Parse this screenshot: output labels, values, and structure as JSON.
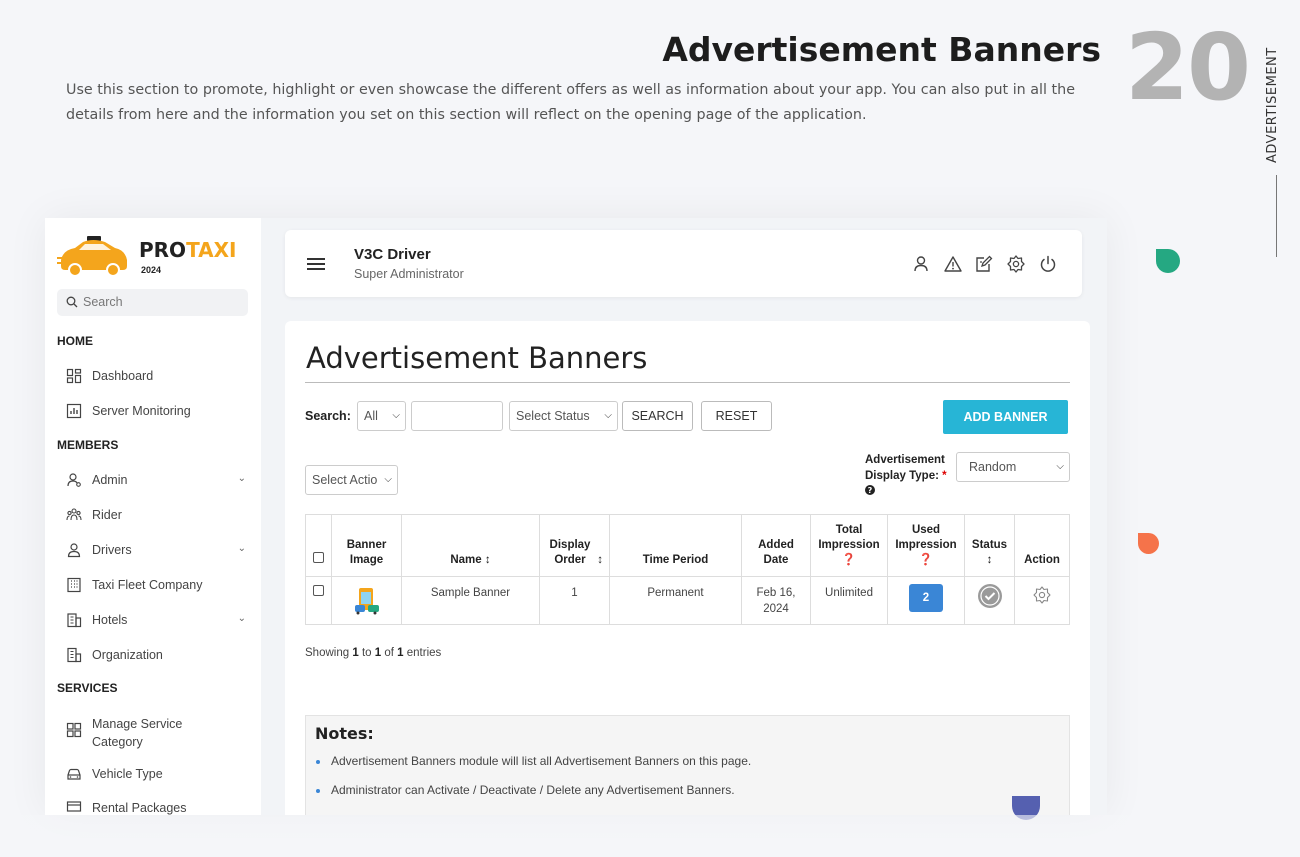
{
  "doc": {
    "title": "Advertisement Banners",
    "description": "Use this section to promote, highlight or even showcase the different offers as well as information about your app. You can also put in all the details from here and the information you set on this section will reflect on the opening page of the application.",
    "number": "20",
    "side_label": "ADVERTISEMENT"
  },
  "brand": {
    "name_a": "PRO",
    "name_b": "TAXI",
    "year": "2024",
    "accent": "#f4a51c"
  },
  "sidebar": {
    "search_placeholder": "Search",
    "sections": {
      "home": "HOME",
      "members": "MEMBERS",
      "services": "SERVICES"
    },
    "items": [
      {
        "label": "Dashboard",
        "icon": "dashboard-icon"
      },
      {
        "label": "Server Monitoring",
        "icon": "chart-icon"
      },
      {
        "label": "Admin",
        "icon": "admin-icon",
        "expandable": true
      },
      {
        "label": "Rider",
        "icon": "rider-icon"
      },
      {
        "label": "Drivers",
        "icon": "driver-icon",
        "expandable": true
      },
      {
        "label": "Taxi Fleet Company",
        "icon": "building-icon"
      },
      {
        "label": "Hotels",
        "icon": "hotel-icon",
        "expandable": true
      },
      {
        "label": "Organization",
        "icon": "organization-icon"
      },
      {
        "label": "Manage Service Category",
        "icon": "grid-icon"
      },
      {
        "label": "Vehicle Type",
        "icon": "car-icon"
      },
      {
        "label": "Rental Packages",
        "icon": "package-icon"
      }
    ]
  },
  "header": {
    "user_name": "V3C Driver",
    "user_role": "Super Administrator",
    "icons": [
      "profile-icon",
      "alert-icon",
      "edit-icon",
      "settings-icon",
      "power-icon"
    ]
  },
  "main": {
    "title": "Advertisement Banners",
    "search_label": "Search:",
    "search_field_value": "All",
    "search_input_value": "",
    "status_select": "Select Status",
    "search_button": "SEARCH",
    "reset_button": "RESET",
    "add_button": "ADD BANNER",
    "action_select": "Select Actio",
    "display_type_label": "Advertisement Display Type:",
    "display_type_value": "Random",
    "columns": [
      "Banner Image",
      "Name",
      "Display Order",
      "Time Period",
      "Added Date",
      "Total Impression",
      "Used Impression",
      "Status",
      "Action"
    ],
    "rows": [
      {
        "name": "Sample Banner",
        "display_order": "1",
        "time_period": "Permanent",
        "added_date": "Feb 16, 2024",
        "total_impression": "Unlimited",
        "used_impression": "2"
      }
    ],
    "entries": {
      "prefix": "Showing",
      "from": "1",
      "to_word": "to",
      "to": "1",
      "of_word": "of",
      "total": "1",
      "suffix": "entries"
    },
    "notes_title": "Notes:",
    "notes": [
      "Advertisement Banners module will list all Advertisement Banners on this page.",
      "Administrator can Activate / Deactivate / Delete any Advertisement Banners."
    ]
  },
  "colors": {
    "add_button": "#27b5d6",
    "impression_button": "#3a86d6",
    "deco_green": "#25a882",
    "deco_orange": "#f5734a"
  }
}
